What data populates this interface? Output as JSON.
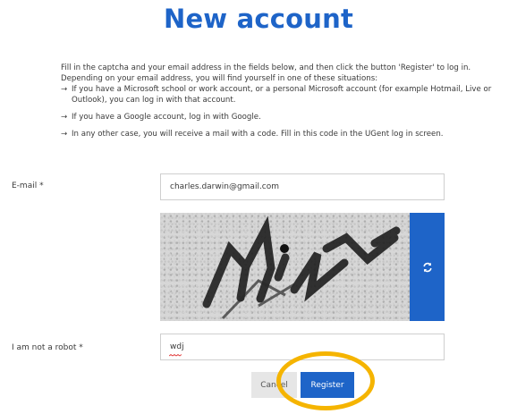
{
  "page": {
    "title": "New account"
  },
  "intro": {
    "paragraph": "Fill in the captcha and your email address in the fields below, and then click the button 'Register' to log in. Depending on your email address, you will find yourself in one of these situations:",
    "bullets": [
      "If you have a Microsoft school or work account, or a personal Microsoft account (for example Hotmail, Live or Outlook), you can log in with that account.",
      "If you have a Google account, log in with Google.",
      "In any other case, you will receive a mail with a code. Fill in this code in the UGent log in screen."
    ],
    "arrow": "→"
  },
  "form": {
    "email_label": "E-mail *",
    "email_value": "charles.darwin@gmail.com",
    "captcha_label": "I am not a robot *",
    "captcha_value": "wdj",
    "refresh_icon": "refresh-icon"
  },
  "actions": {
    "cancel_label": "Cancel",
    "register_label": "Register"
  },
  "colors": {
    "accent": "#1e64c8",
    "highlight": "#f5b400"
  }
}
